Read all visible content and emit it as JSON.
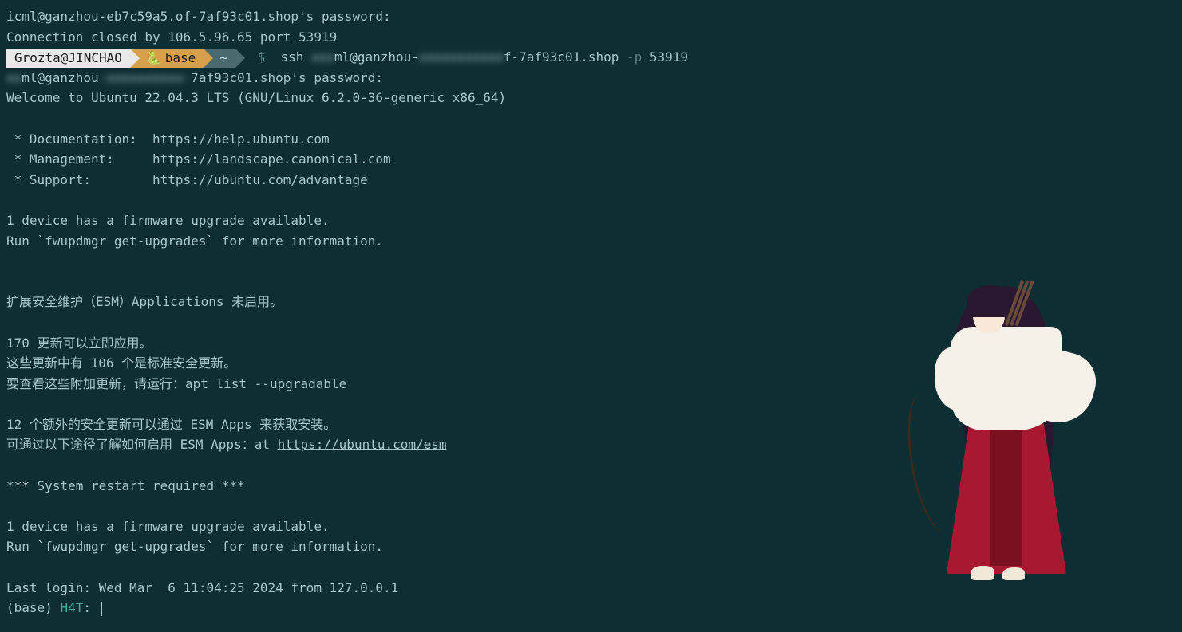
{
  "terminal": {
    "lines": [
      {
        "text": "icml@ganzhou-eb7c59a5.of-7af93c01.shop's password:"
      },
      {
        "text": "Connection closed by 106.5.96.65 port 53919"
      }
    ],
    "prompt": {
      "user": "Grozta@JINCHAO",
      "conda": "base",
      "path": "~",
      "symbol": "$",
      "cmd_ssh": " ssh ",
      "cmd_blur1": "xxx",
      "cmd_host_mid": "ml@ganzhou-",
      "cmd_blur2": "xxxxxxxxxxx",
      "cmd_host_end": "f-7af93c01.shop ",
      "cmd_flag": "-p",
      "cmd_port": " 53919"
    },
    "after": [
      {
        "parts": [
          {
            "blur": true,
            "text": "xx"
          },
          {
            "text": "ml@ganzhou"
          },
          {
            "blur": true,
            "text": "-xxxxxxxxxx-"
          },
          {
            "text": "7af93c01.shop's password:"
          }
        ]
      },
      {
        "text": "Welcome to Ubuntu 22.04.3 LTS (GNU/Linux 6.2.0-36-generic x86_64)"
      },
      {
        "text": ""
      },
      {
        "text": " * Documentation:  https://help.ubuntu.com"
      },
      {
        "text": " * Management:     https://landscape.canonical.com"
      },
      {
        "text": " * Support:        https://ubuntu.com/advantage"
      },
      {
        "text": ""
      },
      {
        "text": "1 device has a firmware upgrade available."
      },
      {
        "text": "Run `fwupdmgr get-upgrades` for more information."
      },
      {
        "text": ""
      },
      {
        "text": ""
      },
      {
        "text": "扩展安全维护（ESM）Applications 未启用。"
      },
      {
        "text": ""
      },
      {
        "text": "170 更新可以立即应用。"
      },
      {
        "text": "这些更新中有 106 个是标准安全更新。"
      },
      {
        "text": "要查看这些附加更新，请运行：apt list --upgradable"
      },
      {
        "text": ""
      },
      {
        "text": "12 个额外的安全更新可以通过 ESM Apps 来获取安装。"
      },
      {
        "parts": [
          {
            "text": "可通过以下途径了解如何启用 ESM Apps：at "
          },
          {
            "link": true,
            "text": "https://ubuntu.com/esm"
          }
        ]
      },
      {
        "text": ""
      },
      {
        "text": "*** System restart required ***"
      },
      {
        "text": ""
      },
      {
        "text": "1 device has a firmware upgrade available."
      },
      {
        "text": "Run `fwupdmgr get-upgrades` for more information."
      },
      {
        "text": ""
      },
      {
        "text": "Last login: Wed Mar  6 11:04:25 2024 from 127.0.0.1"
      }
    ],
    "shell_prompt": {
      "base": "(base) ",
      "host": "H4T",
      "sep": ": "
    }
  }
}
